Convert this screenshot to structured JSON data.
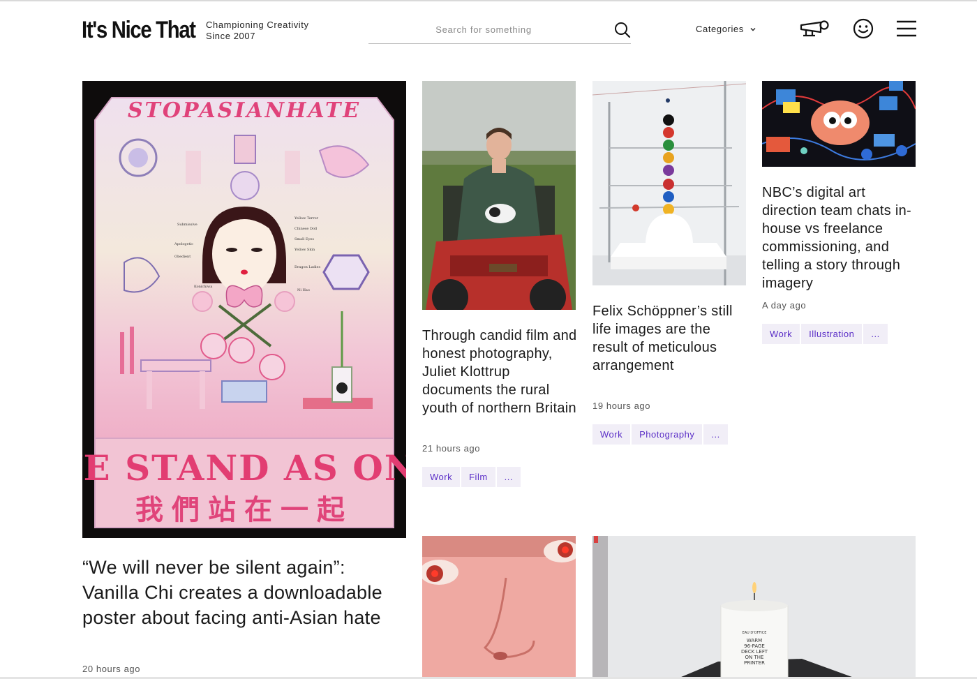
{
  "header": {
    "logo": "It's Nice That",
    "tagline_line1": "Championing Creativity",
    "tagline_line2": "Since 2007",
    "search_placeholder": "Search for something",
    "categories_label": "Categories",
    "icons": [
      "search-icon",
      "chevron-down-icon",
      "megaphone-icon",
      "smiley-icon",
      "menu-icon"
    ]
  },
  "articles": [
    {
      "title": "“We will never be silent again”: Vanilla Chi creates a downloadable poster about facing anti-Asian hate",
      "time": "20 hours ago",
      "poster_top_text": "STOPASIANHATE",
      "poster_bottom_text": "WE STAND AS ONE",
      "poster_chinese_text": "我們站在一起",
      "poster_labels": [
        "Yellow Terror",
        "Chinese Doll",
        "Small Eyes",
        "Yellow Skin",
        "Dragon Ladies",
        "Ni Hao",
        "Submissive",
        "Apologetic",
        "Obedient",
        "Konichiwa"
      ],
      "tags": []
    },
    {
      "title": "Through candid film and honest photography, Juliet Klottrup documents the rural youth of northern Britain",
      "time": "21 hours ago",
      "tags": [
        "Work",
        "Film",
        "..."
      ]
    },
    {
      "title": "Felix Schöppner’s still life images are the result of meticulous arrangement",
      "time": "19 hours ago",
      "tags": [
        "Work",
        "Photography",
        "..."
      ]
    },
    {
      "title": "NBC’s digital art direction team chats in-house vs freelance commissioning, and telling a story through imagery",
      "time": "A day ago",
      "tags": [
        "Work",
        "Illustration",
        "..."
      ]
    }
  ],
  "candle_label": [
    "EAU D'OFFICE",
    "WARM",
    "96-PAGE",
    "DECK LEFT",
    "ON THE",
    "PRINTER"
  ],
  "colors": {
    "tag_bg": "#f1eef7",
    "tag_text": "#5b2fc7",
    "text": "#1a1a1a",
    "meta": "#555555"
  }
}
